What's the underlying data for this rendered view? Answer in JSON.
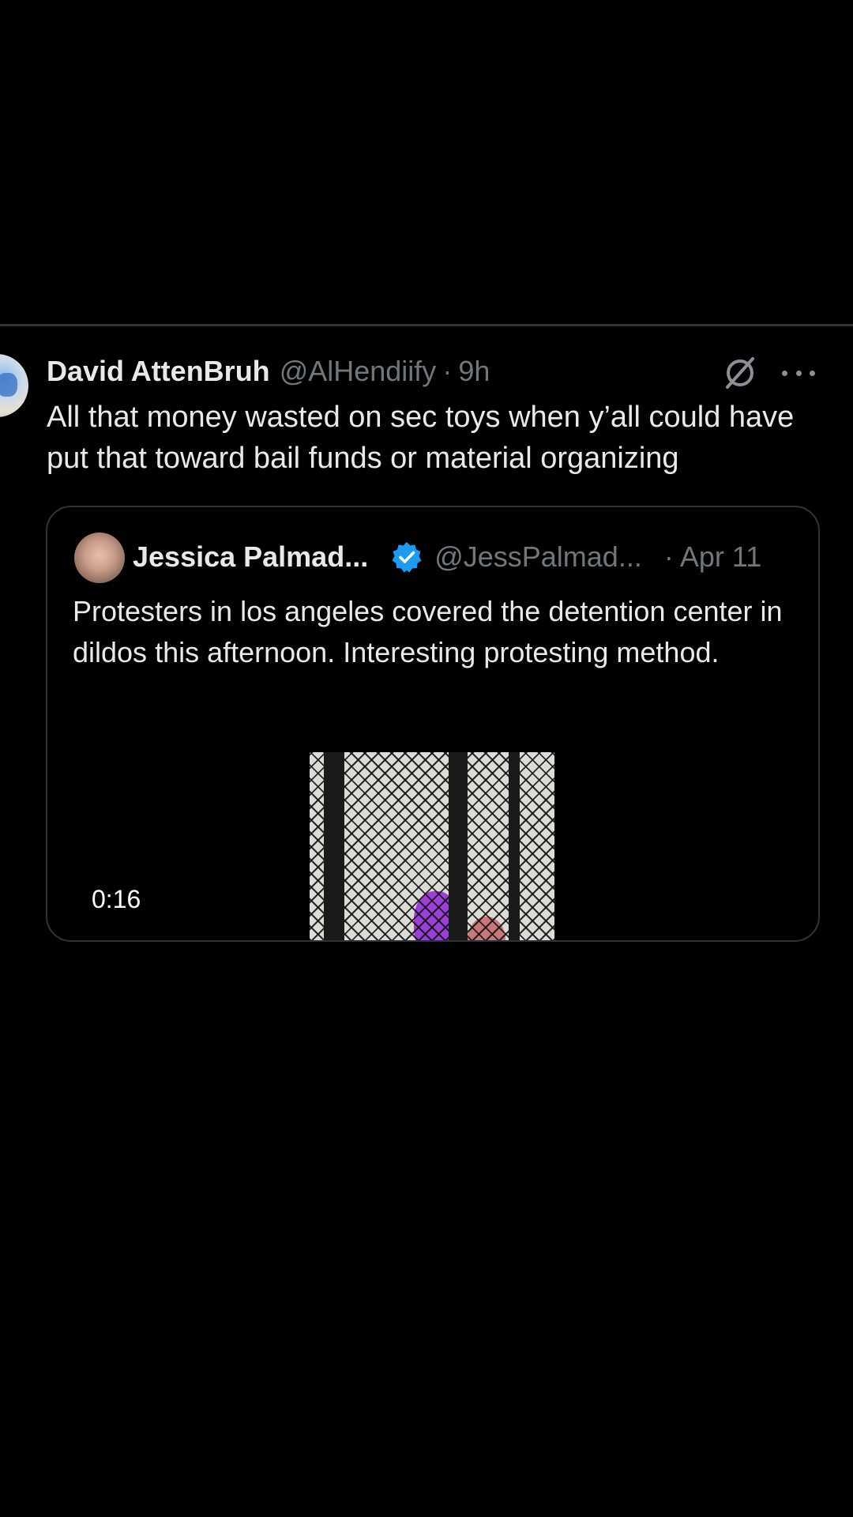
{
  "post": {
    "author_name": "David AttenBruh",
    "handle": "@AlHendiify",
    "separator": "·",
    "time": "9h",
    "text": "All that money wasted on sec toys when y’all could have put that toward bail funds or material organizing",
    "icons": {
      "avatar": "avatar",
      "grok": "grok-icon",
      "more": "more-icon"
    }
  },
  "quoted_post": {
    "author_name": "Jessica Palmad...",
    "handle": "@JessPalmad...",
    "separator": "·",
    "time": "Apr 11",
    "text": "Protesters in los angeles covered the detention center in dildos this afternoon. Interesting protesting method.",
    "verified_color": "#1d9bf0",
    "video": {
      "duration": "0:16"
    }
  },
  "colors": {
    "background": "#000000",
    "text_primary": "#e7e9ea",
    "text_secondary": "#71767b",
    "border": "#2f3336"
  }
}
